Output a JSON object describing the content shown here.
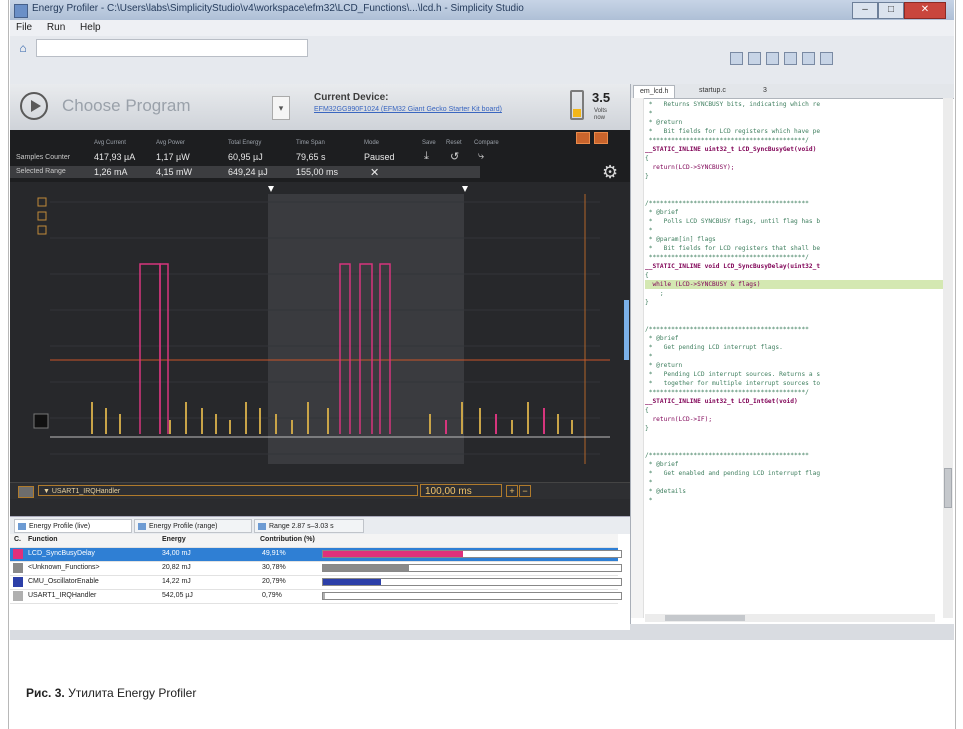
{
  "window": {
    "title": "Energy Profiler - C:\\Users\\labs\\SimplicityStudio\\v4\\workspace\\efm32\\LCD_Functions\\...\\lcd.h - Simplicity Studio",
    "menu": [
      "File",
      "Run",
      "Help"
    ]
  },
  "control": {
    "play_label": "Choose Program",
    "device_label": "Current Device:",
    "device_link": "EFM32GG990F1024 (EFM32 Giant Gecko Starter Kit board)",
    "voltage": "3.5",
    "voltage_unit_line1": "Volts",
    "voltage_unit_line2": "now"
  },
  "stats": {
    "headers": [
      "Avg Current",
      "Avg Power",
      "Total Energy",
      "Time Span",
      "Mode",
      "Save",
      "Reset",
      "Compare"
    ],
    "row1_label": "Samples Counter",
    "row1": [
      "417,93 µA",
      "1,17 µW",
      "60,95 µJ",
      "79,65 s",
      "Paused"
    ],
    "row2_label": "Selected Range",
    "row2": [
      "1,26 mA",
      "4,15 mW",
      "649,24 µJ",
      "155,00 ms"
    ],
    "close_symbol": "✕"
  },
  "trackbar": {
    "function_name": "▼ USART1_IRQHandler",
    "time_window": "100,00 ms",
    "plus": "+",
    "minus": "−"
  },
  "tabs": [
    "Energy Profile (live)",
    "Energy Profile (range)",
    "Range 2.87 s–3.03 s"
  ],
  "table": {
    "headers": [
      "C.",
      "Function",
      "Energy",
      "Contribution (%)"
    ],
    "rows": [
      {
        "name": "LCD_SyncBusyDelay",
        "energy": "34,00 mJ",
        "pct_label": "49,91%",
        "pct": 49.91,
        "color": "#e0307a",
        "selected": true
      },
      {
        "name": "<Unknown_Functions>",
        "energy": "20,82 mJ",
        "pct_label": "30,78%",
        "pct": 30.78,
        "color": "#8a8a8a",
        "selected": false
      },
      {
        "name": "CMU_OscillatorEnable",
        "energy": "14,22 mJ",
        "pct_label": "20,79%",
        "pct": 20.79,
        "color": "#2c3fa8",
        "selected": false
      },
      {
        "name": "USART1_IRQHandler",
        "energy": "542,05 µJ",
        "pct_label": "0,79%",
        "pct": 0.79,
        "color": "#b0b0b0",
        "selected": false
      }
    ]
  },
  "editor": {
    "tabs": [
      "em_lcd.h",
      "startup.c",
      "3"
    ],
    "lines": [
      " *   Returns SYNCBUSY bits, indicating which re",
      " *",
      " * @return",
      " *   Bit fields for LCD registers which have pe",
      " ******************************************/",
      "__STATIC_INLINE uint32_t LCD_SyncBusyGet(void)",
      "{",
      "  return(LCD->SYNCBUSY);",
      "}",
      "",
      "",
      "/*******************************************",
      " * @brief",
      " *   Polls LCD SYNCBUSY flags, until flag has b",
      " *",
      " * @param[in] flags",
      " *   Bit fields for LCD registers that shall be",
      " ******************************************/",
      "__STATIC_INLINE void LCD_SyncBusyDelay(uint32_t",
      "{",
      "  while (LCD->SYNCBUSY & flags)",
      "    ;",
      "}",
      "",
      "",
      "/*******************************************",
      " * @brief",
      " *   Get pending LCD interrupt flags.",
      " *",
      " * @return",
      " *   Pending LCD interrupt sources. Returns a s",
      " *   together for multiple interrupt sources to",
      " ******************************************/",
      "__STATIC_INLINE uint32_t LCD_IntGet(void)",
      "{",
      "  return(LCD->IF);",
      "}",
      "",
      "",
      "/*******************************************",
      " * @brief",
      " *   Get enabled and pending LCD interrupt flag",
      " *",
      " * @details",
      " *"
    ]
  },
  "caption": {
    "bold": "Рис. 3.",
    "text": " Утилита Energy Profiler"
  }
}
